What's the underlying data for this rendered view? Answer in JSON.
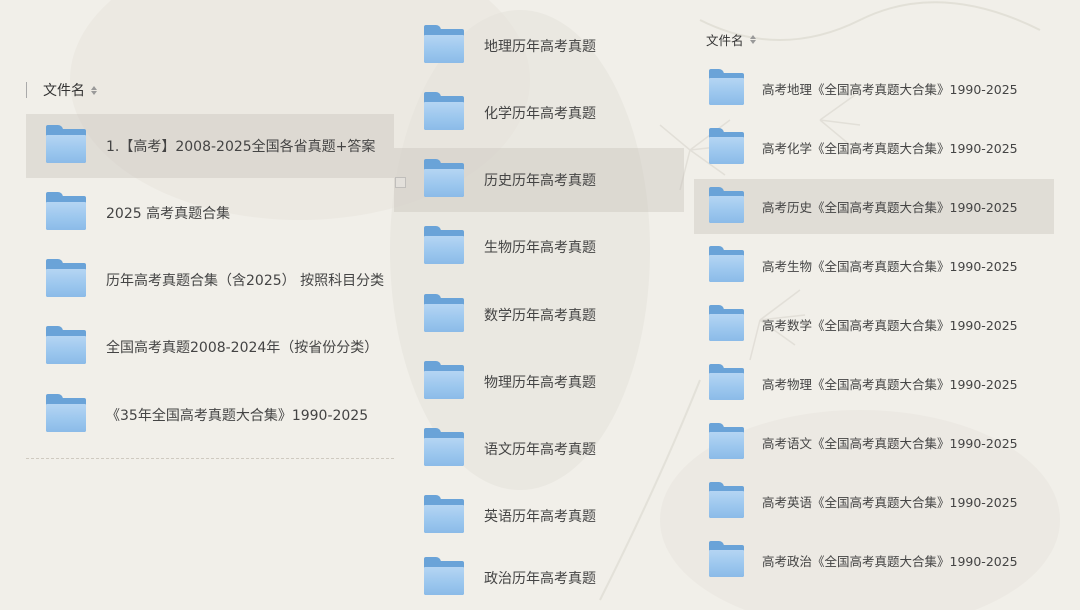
{
  "panel_left": {
    "header": {
      "label": "文件名"
    },
    "items": [
      {
        "label": "1.【高考】2008-2025全国各省真题+答案"
      },
      {
        "label": "2025 高考真题合集"
      },
      {
        "label": "历年高考真题合集（含2025）  按照科目分类"
      },
      {
        "label": "全国高考真题2008-2024年（按省份分类）"
      },
      {
        "label": "《35年全国高考真题大合集》1990-2025"
      }
    ]
  },
  "panel_middle": {
    "items": [
      {
        "label": "地理历年高考真题"
      },
      {
        "label": "化学历年高考真题"
      },
      {
        "label": "历史历年高考真题"
      },
      {
        "label": "生物历年高考真题"
      },
      {
        "label": "数学历年高考真题"
      },
      {
        "label": "物理历年高考真题"
      },
      {
        "label": "语文历年高考真题"
      },
      {
        "label": "英语历年高考真题"
      },
      {
        "label": "政治历年高考真题"
      }
    ]
  },
  "panel_right": {
    "header": {
      "label": "文件名"
    },
    "items": [
      {
        "label": "高考地理《全国高考真题大合集》1990-2025"
      },
      {
        "label": "高考化学《全国高考真题大合集》1990-2025"
      },
      {
        "label": "高考历史《全国高考真题大合集》1990-2025"
      },
      {
        "label": "高考生物《全国高考真题大合集》1990-2025"
      },
      {
        "label": "高考数学《全国高考真题大合集》1990-2025"
      },
      {
        "label": "高考物理《全国高考真题大合集》1990-2025"
      },
      {
        "label": "高考语文《全国高考真题大合集》1990-2025"
      },
      {
        "label": "高考英语《全国高考真题大合集》1990-2025"
      },
      {
        "label": "高考政治《全国高考真题大合集》1990-2025"
      }
    ]
  },
  "colors": {
    "background": "#f1efe9",
    "folder_back": "#6aa3d8",
    "folder_front": "#9cc7ee",
    "selected_row": "#ddd9d2"
  },
  "icons": {
    "folder": "folder-icon",
    "sort": "sort-icon"
  }
}
